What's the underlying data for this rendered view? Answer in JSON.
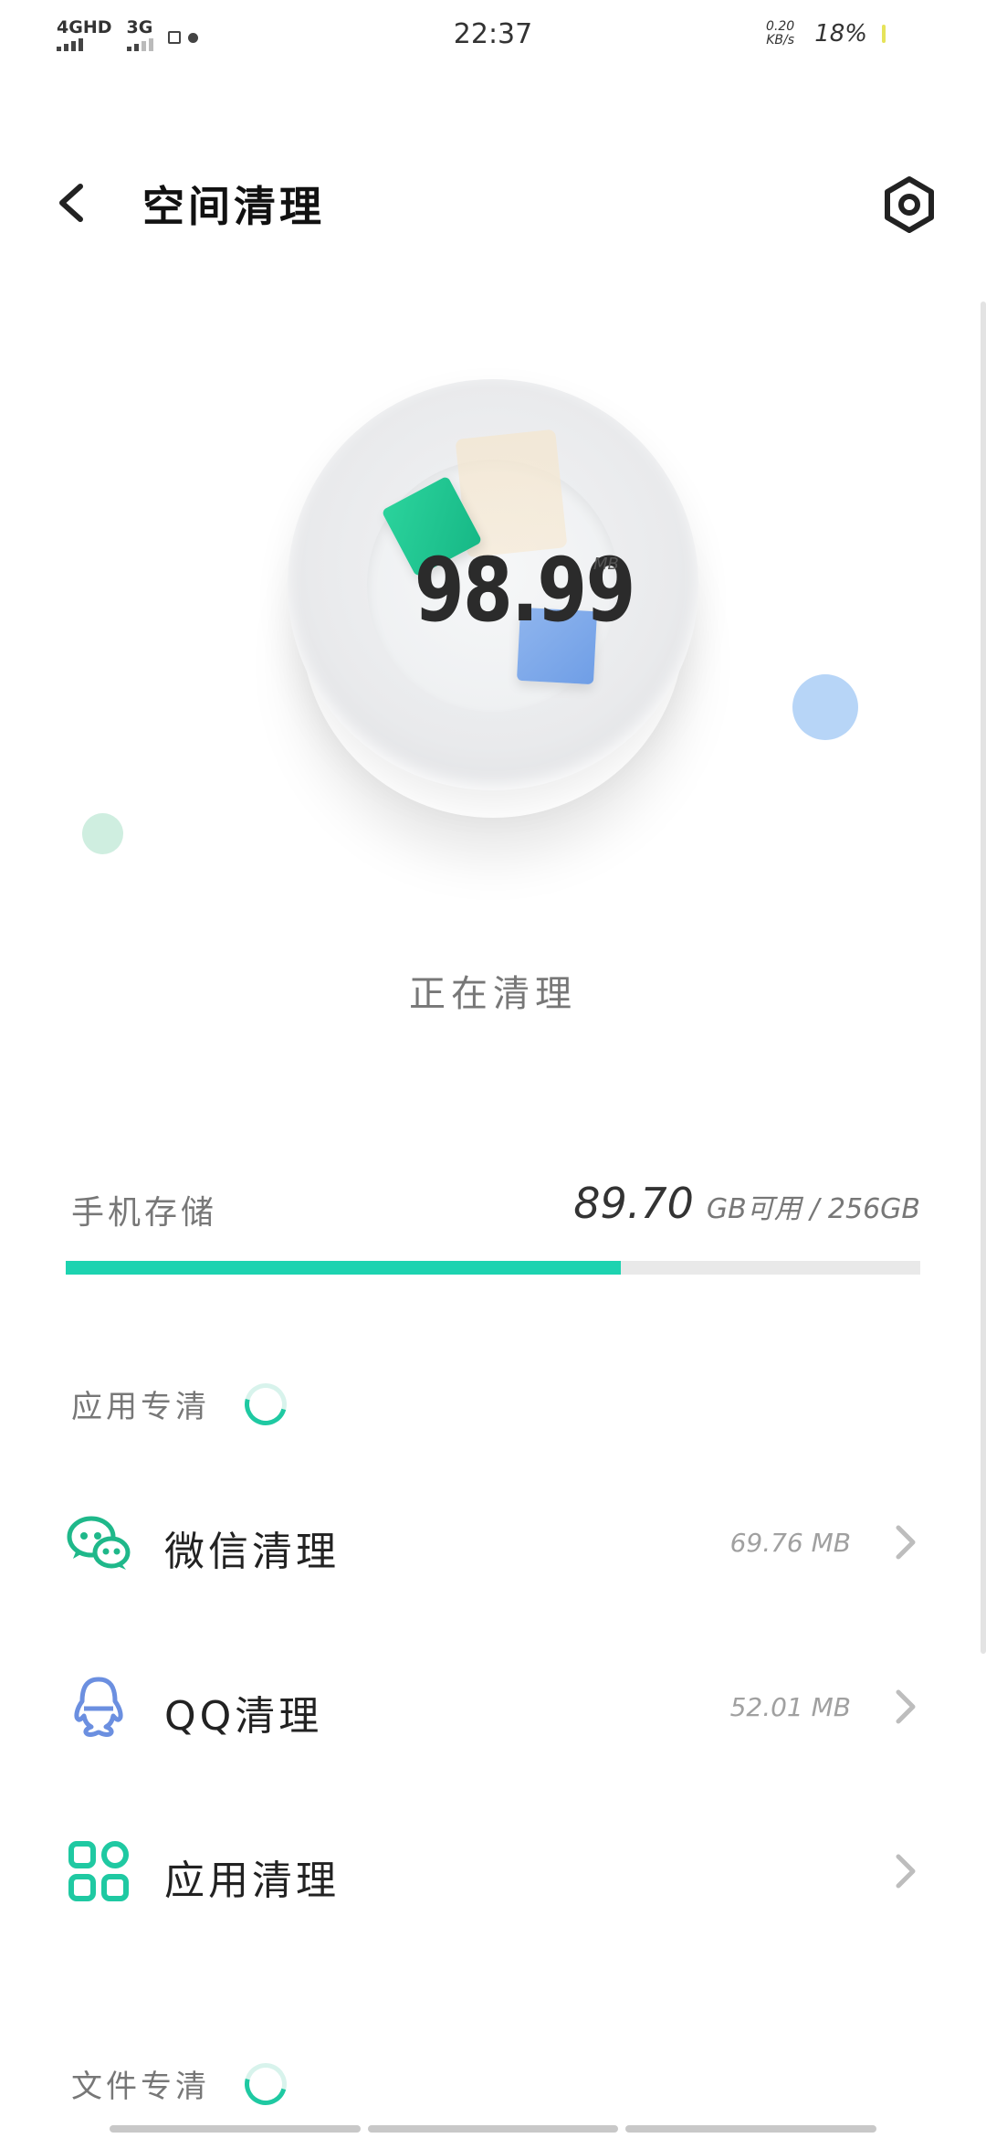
{
  "status_bar": {
    "network_1": "4GHD",
    "network_2": "3G",
    "time": "22:37",
    "net_speed_value": "0.20",
    "net_speed_unit": "KB/s",
    "battery": "18%"
  },
  "header": {
    "title": "空间清理"
  },
  "hero": {
    "size_value": "98.99",
    "size_unit": "MB",
    "status_text": "正在清理"
  },
  "storage": {
    "label": "手机存储",
    "free_value": "89.70",
    "free_suffix": "GB可用 / 256GB",
    "used_fraction": 0.65
  },
  "sections": [
    {
      "title": "应用专清",
      "items": [
        {
          "label": "微信清理",
          "value": "69.76 MB",
          "icon": "wechat-icon"
        },
        {
          "label": "QQ清理",
          "value": "52.01 MB",
          "icon": "qq-icon"
        },
        {
          "label": "应用清理",
          "value": "",
          "icon": "apps-grid-icon"
        }
      ]
    },
    {
      "title": "文件专清"
    }
  ],
  "colors": {
    "accent": "#1dd3b0",
    "wechat": "#1fb88a",
    "qq": "#6b8fe0",
    "apps": "#1fc9a2"
  }
}
